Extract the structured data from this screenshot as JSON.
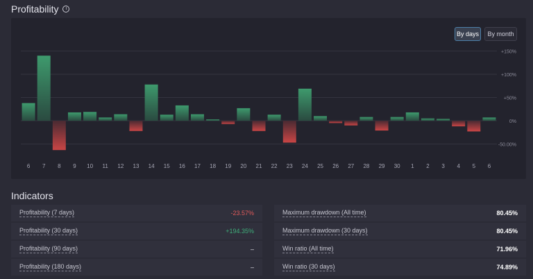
{
  "header": {
    "title": "Profitability",
    "info_icon": "info-icon"
  },
  "buttons": {
    "by_days": "By days",
    "by_month": "By month",
    "active": "by_days"
  },
  "chart_data": {
    "type": "bar",
    "categories": [
      "6",
      "7",
      "8",
      "9",
      "10",
      "11",
      "12",
      "13",
      "14",
      "15",
      "16",
      "17",
      "18",
      "19",
      "20",
      "21",
      "22",
      "23",
      "24",
      "25",
      "26",
      "27",
      "28",
      "29",
      "30",
      "1",
      "2",
      "3",
      "4",
      "5",
      "6"
    ],
    "values": [
      38,
      140,
      -63,
      18,
      19,
      7,
      14,
      -22,
      78,
      13,
      33,
      14,
      3,
      -7,
      27,
      -22,
      13,
      -47,
      69,
      10,
      -5,
      -10,
      8,
      -21,
      8,
      18,
      5,
      4,
      -12,
      -23,
      7
    ],
    "y_ticks": [
      150,
      100,
      50,
      0,
      -50
    ],
    "y_tick_labels": [
      "+150%",
      "+100%",
      "+50%",
      "0%",
      "-50.00%"
    ],
    "ylim": [
      -75,
      160
    ],
    "positive_color": "#3e9a6d",
    "negative_color": "#c94545"
  },
  "indicators": {
    "title": "Indicators",
    "left": [
      {
        "label": "Profitability (7 days)",
        "value": "-23.57%",
        "style": "neg"
      },
      {
        "label": "Profitability (30 days)",
        "value": "+194.35%",
        "style": "pos"
      },
      {
        "label": "Profitability (90 days)",
        "value": "–",
        "style": "plain"
      },
      {
        "label": "Profitability (180 days)",
        "value": "–",
        "style": "plain"
      }
    ],
    "right": [
      {
        "label": "Maximum drawdown (All time)",
        "value": "80.45%",
        "style": "bold"
      },
      {
        "label": "Maximum drawdown (30 days)",
        "value": "80.45%",
        "style": "bold"
      },
      {
        "label": "Win ratio (All time)",
        "value": "71.96%",
        "style": "bold"
      },
      {
        "label": "Win ratio (30 days)",
        "value": "74.89%",
        "style": "bold"
      }
    ]
  }
}
